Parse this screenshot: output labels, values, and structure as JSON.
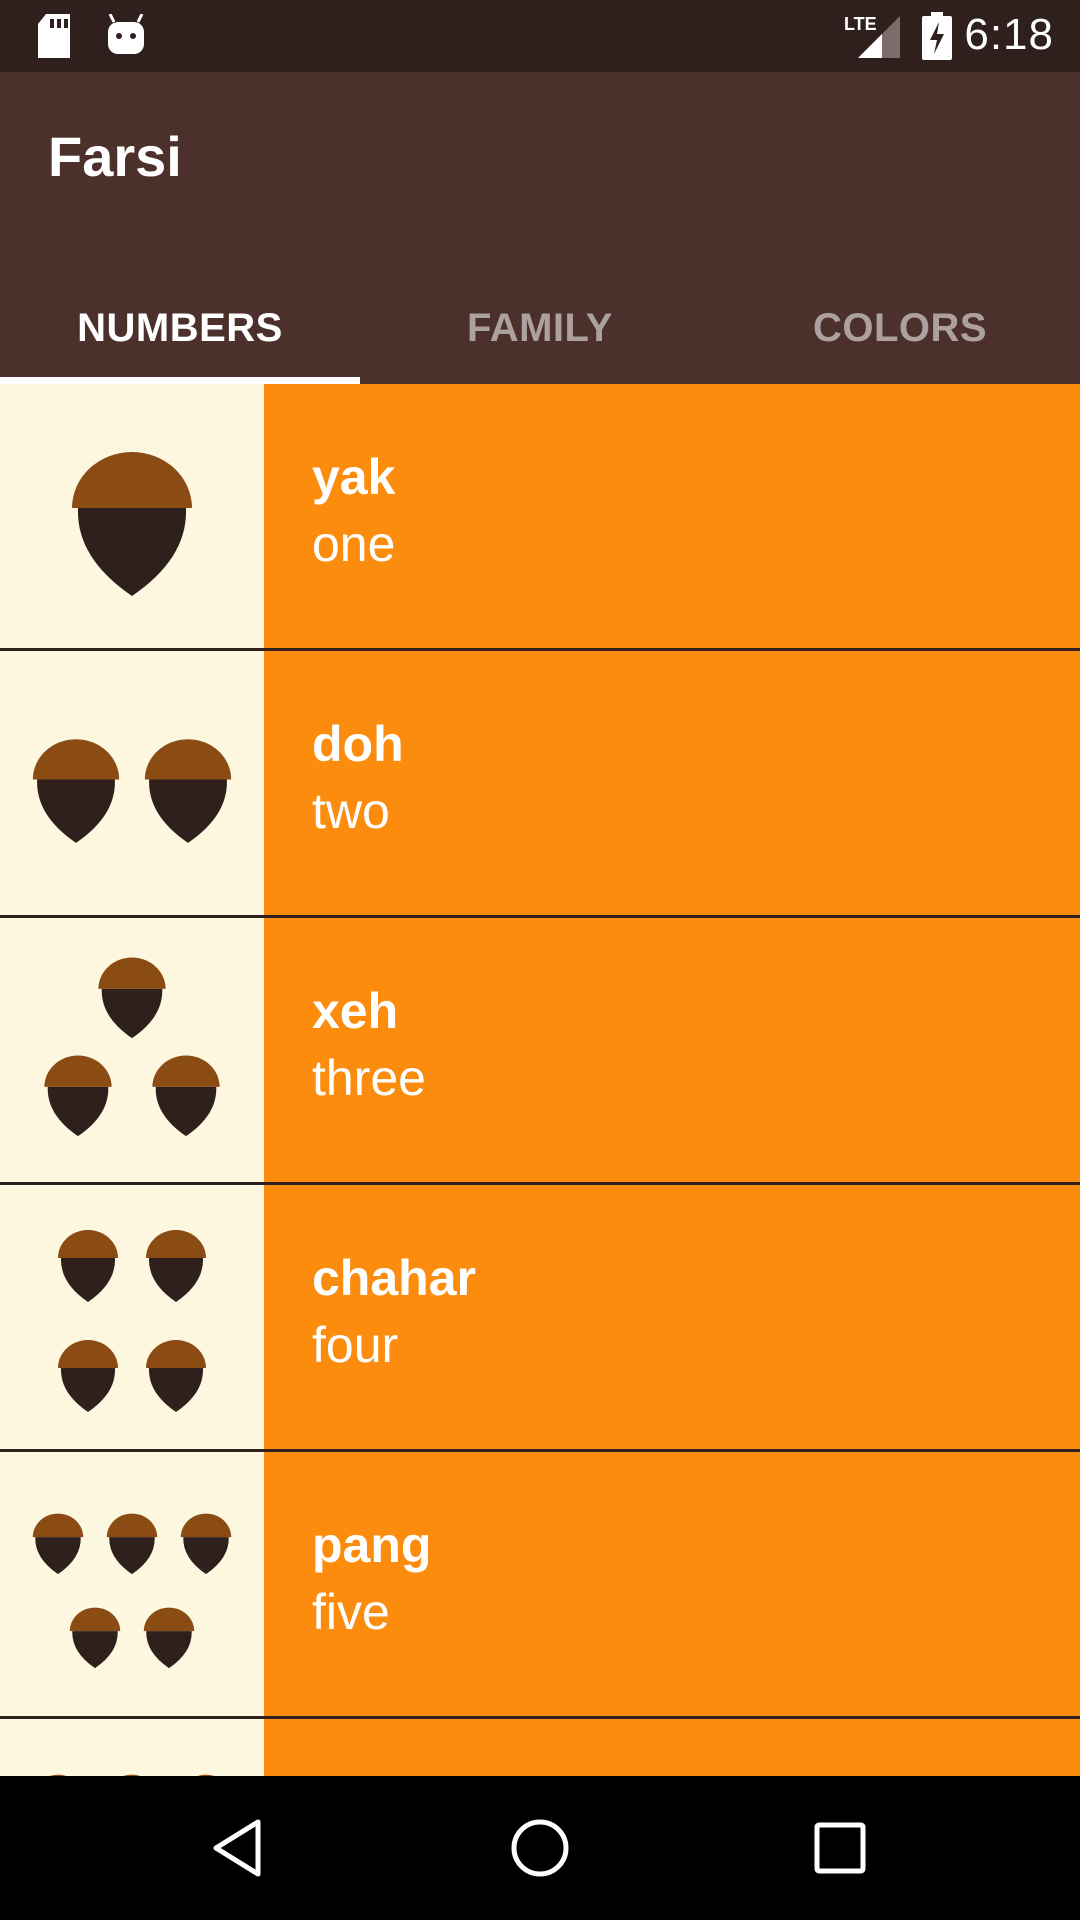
{
  "status_bar": {
    "time": "6:18",
    "network": "LTE",
    "icons": [
      "sd-card-icon",
      "android-debug-icon",
      "lte-signal-icon",
      "battery-charging-icon"
    ]
  },
  "app_bar": {
    "title": "Farsi"
  },
  "tabs": [
    {
      "label": "NUMBERS",
      "selected": true
    },
    {
      "label": "FAMILY",
      "selected": false
    },
    {
      "label": "COLORS",
      "selected": false
    }
  ],
  "words": [
    {
      "farsi": "yak",
      "english": "one",
      "image": "one-acorn"
    },
    {
      "farsi": "doh",
      "english": "two",
      "image": "two-acorns"
    },
    {
      "farsi": "xeh",
      "english": "three",
      "image": "three-acorns"
    },
    {
      "farsi": "chahar",
      "english": "four",
      "image": "four-acorns"
    },
    {
      "farsi": "pang",
      "english": "five",
      "image": "five-acorns"
    }
  ],
  "nav_bar": {
    "buttons": [
      "back-icon",
      "home-icon",
      "recents-icon"
    ]
  },
  "colors": {
    "status_bar": "#2f1f1d",
    "app_bar": "#4b302b",
    "list_background": "#fb8c0d",
    "thumb_background": "#fdf7e0",
    "acorn_cap": "#8b4c14",
    "acorn_body": "#2f1f1d"
  }
}
